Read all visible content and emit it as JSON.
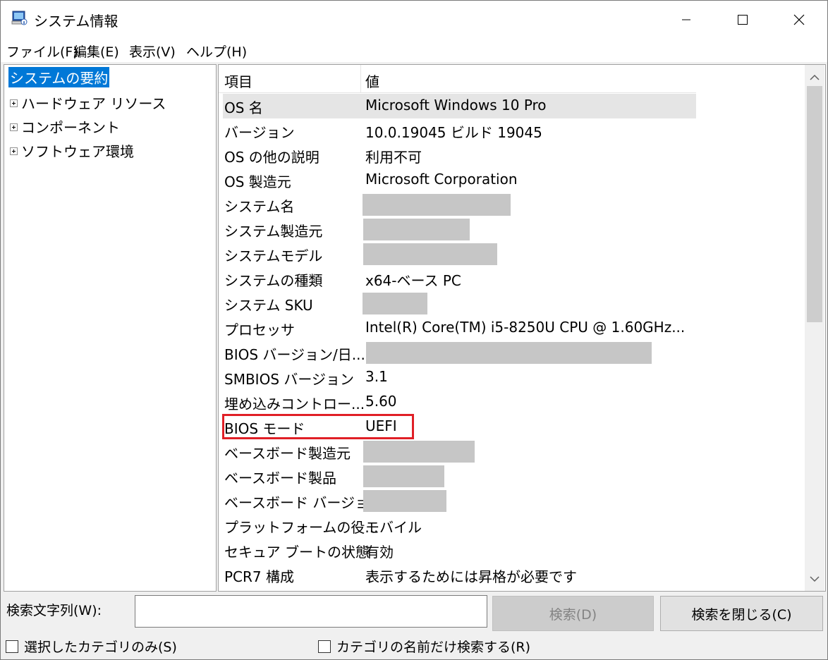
{
  "window": {
    "title": "システム情報"
  },
  "menu": [
    "ファイル(F)",
    "編集(E)",
    "表示(V)",
    "ヘルプ(H)"
  ],
  "tree": {
    "selected": "システムの要約",
    "children": [
      "ハードウェア リソース",
      "コンポーネント",
      "ソフトウェア環境"
    ]
  },
  "table": {
    "headers": {
      "item": "項目",
      "value": "値"
    },
    "rows": [
      {
        "name": "OS 名",
        "value": "Microsoft Windows 10 Pro"
      },
      {
        "name": "バージョン",
        "value": "10.0.19045 ビルド 19045"
      },
      {
        "name": "OS の他の説明",
        "value": "利用不可"
      },
      {
        "name": "OS 製造元",
        "value": "Microsoft Corporation"
      },
      {
        "name": "システム名",
        "value": ""
      },
      {
        "name": "システム製造元",
        "value": ""
      },
      {
        "name": "システムモデル",
        "value": ""
      },
      {
        "name": "システムの種類",
        "value": "x64-ベース PC"
      },
      {
        "name": "システム SKU",
        "value": ""
      },
      {
        "name": "プロセッサ",
        "value": "Intel(R) Core(TM) i5-8250U CPU @ 1.60GHz..."
      },
      {
        "name": "BIOS バージョン/日...",
        "value": ""
      },
      {
        "name": "SMBIOS バージョン",
        "value": "3.1"
      },
      {
        "name": "埋め込みコントロー...",
        "value": "5.60"
      },
      {
        "name": "BIOS モード",
        "value": "UEFI"
      },
      {
        "name": "ベースボード製造元",
        "value": ""
      },
      {
        "name": "ベースボード製品",
        "value": ""
      },
      {
        "name": "ベースボード バージョン",
        "value": ""
      },
      {
        "name": "プラットフォームの役...",
        "value": "モバイル"
      },
      {
        "name": "セキュア ブートの状態",
        "value": "有効"
      },
      {
        "name": "PCR7 構成",
        "value": "表示するためには昇格が必要です"
      }
    ]
  },
  "search": {
    "label": "検索文字列(W):",
    "value": "",
    "search_button": "検索(D)",
    "close_button": "検索を閉じる(C)",
    "checkbox_selected_only": "選択したカテゴリのみ(S)",
    "checkbox_names_only": "カテゴリの名前だけ検索する(R)"
  },
  "colors": {
    "selection": "#0078d7",
    "highlight_box": "#e01f26",
    "redaction": "#c6c6c6"
  }
}
